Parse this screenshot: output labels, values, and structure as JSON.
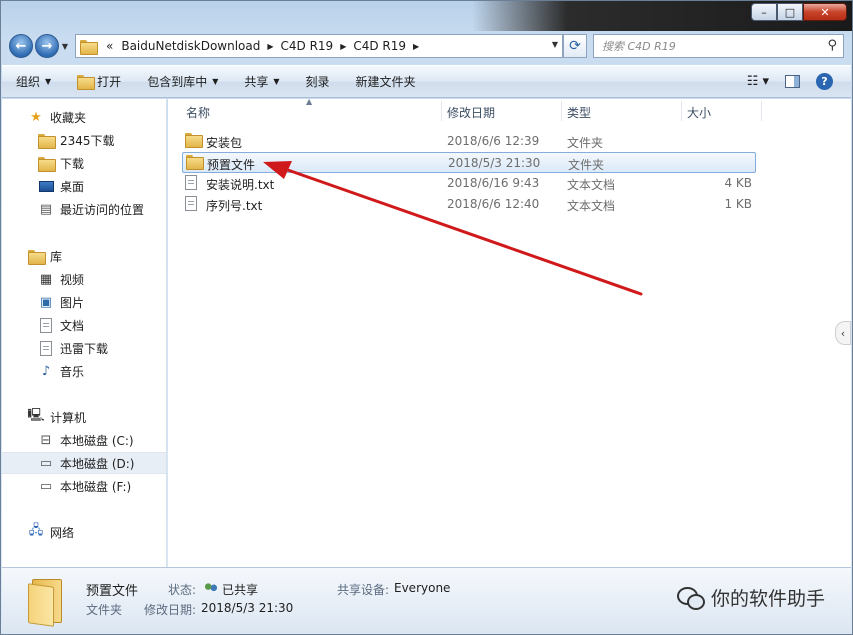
{
  "window": {
    "caption_buttons": {
      "minimize": "–",
      "maximize": "□",
      "close": "✕"
    }
  },
  "address": {
    "overflow": "«",
    "breadcrumbs": [
      "BaiduNetdiskDownload",
      "C4D  R19",
      "C4D R19"
    ]
  },
  "search": {
    "placeholder": "搜索 C4D R19"
  },
  "toolbar": {
    "organize": "组织",
    "open": "打开",
    "include_in_library": "包含到库中",
    "share": "共享",
    "burn": "刻录",
    "new_folder": "新建文件夹"
  },
  "sidebar": {
    "favorites": {
      "header": "收藏夹",
      "items": [
        "2345下载",
        "下载",
        "桌面",
        "最近访问的位置"
      ]
    },
    "libraries": {
      "header": "库",
      "items": [
        "视频",
        "图片",
        "文档",
        "迅雷下载",
        "音乐"
      ]
    },
    "computer": {
      "header": "计算机",
      "items": [
        "本地磁盘 (C:)",
        "本地磁盘 (D:)",
        "本地磁盘 (F:)"
      ],
      "selected": "本地磁盘 (D:)"
    },
    "network": {
      "header": "网络"
    }
  },
  "columns": {
    "name": "名称",
    "modified": "修改日期",
    "type": "类型",
    "size": "大小"
  },
  "files": [
    {
      "name": "安装包",
      "modified": "2018/6/6 12:39",
      "type": "文件夹",
      "size": "",
      "icon": "folder-icon",
      "selected": false
    },
    {
      "name": "预置文件",
      "modified": "2018/5/3 21:30",
      "type": "文件夹",
      "size": "",
      "icon": "folder-icon",
      "selected": true
    },
    {
      "name": "安装说明.txt",
      "modified": "2018/6/16 9:43",
      "type": "文本文档",
      "size": "4 KB",
      "icon": "text-file-icon",
      "selected": false
    },
    {
      "name": "序列号.txt",
      "modified": "2018/6/6 12:40",
      "type": "文本文档",
      "size": "1 KB",
      "icon": "text-file-icon",
      "selected": false
    }
  ],
  "details": {
    "name": "预置文件",
    "kind": "文件夹",
    "state_label": "状态:",
    "state_value": "已共享",
    "modified_label": "修改日期:",
    "modified_value": "2018/5/3 21:30",
    "shared_with_label": "共享设备:",
    "shared_with_value": "Everyone"
  },
  "watermark": {
    "text": "你的软件助手"
  },
  "annotation": {
    "color": "#d0191b"
  }
}
